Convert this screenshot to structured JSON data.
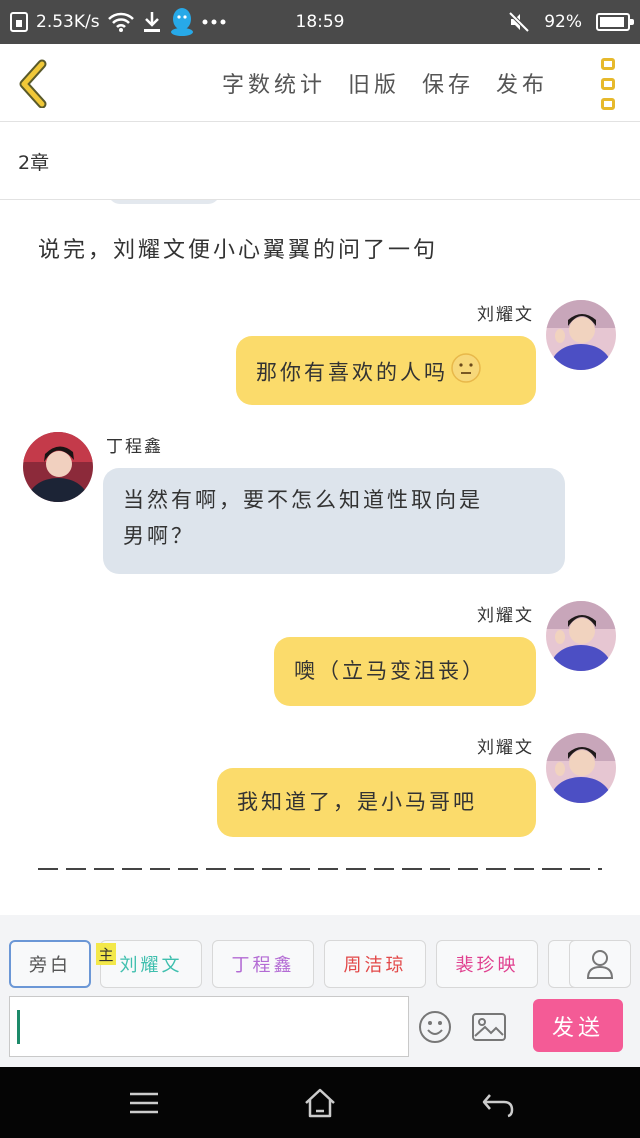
{
  "status_bar": {
    "speed": "2.53K/s",
    "time": "18:59",
    "battery": "92%",
    "battery_level": 0.92
  },
  "toolbar": {
    "word_count": "字数统计",
    "old_version": "旧版",
    "save": "保存",
    "publish": "发布"
  },
  "chapter": {
    "title": "2章"
  },
  "story": {
    "narration": "说完，刘耀文便小心翼翼的问了一句",
    "messages": [
      {
        "speaker": "刘耀文",
        "text": "那你有喜欢的人吗"
      },
      {
        "speaker": "丁程鑫",
        "text_line1": "当然有啊，要不怎么知道性取向是",
        "text_line2": "男啊？"
      },
      {
        "speaker": "刘耀文",
        "text": "噢（立马变沮丧）"
      },
      {
        "speaker": "刘耀文",
        "text": "我知道了，是小马哥吧"
      }
    ]
  },
  "roles": {
    "narrator": "旁白",
    "main_tag": "主",
    "items": [
      "刘耀文",
      "丁程鑫",
      "周洁琼",
      "裴珍映"
    ],
    "colors": {
      "刘耀文": "#3fbfae",
      "丁程鑫": "#b36bd4",
      "周洁琼": "#e24848",
      "裴珍映": "#e0408f"
    }
  },
  "input": {
    "value": "",
    "placeholder": ""
  },
  "send_label": "发送",
  "icons": {
    "back": "chevron-left-icon",
    "more": "more-vertical-icon",
    "user": "user-icon",
    "emoji": "emoji-icon",
    "image": "image-icon",
    "menu": "menu-icon",
    "home": "home-icon",
    "return": "back-arrow-icon"
  }
}
